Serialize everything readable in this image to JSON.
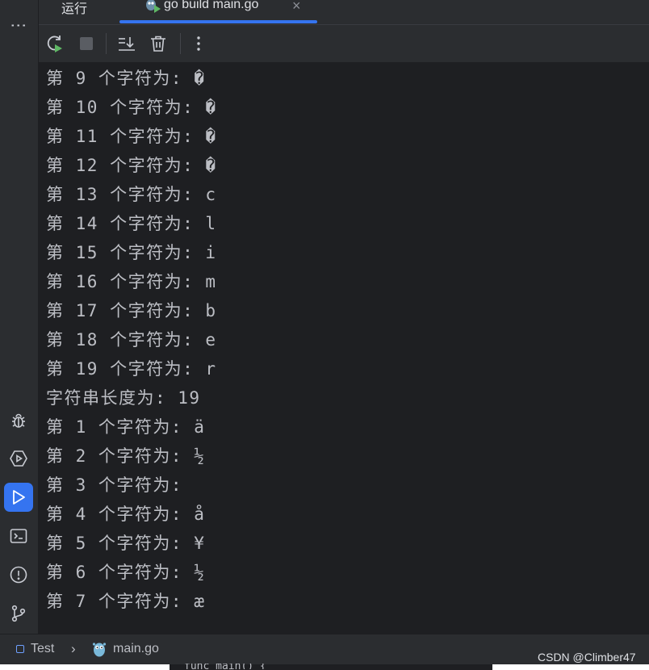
{
  "tabs": {
    "run_label": "运行",
    "active_label": "go build main.go",
    "close_glyph": "×"
  },
  "left_strip": {
    "more_glyph": "⋮",
    "icons": [
      "debug-icon",
      "services-icon",
      "run-icon",
      "terminal-icon",
      "problems-icon",
      "git-icon"
    ],
    "active": "run-icon"
  },
  "toolbar": {
    "icons": [
      "rerun-icon",
      "stop-icon",
      "scroll-to-end-icon",
      "clear-all-icon",
      "more-icon"
    ]
  },
  "console": {
    "lines": [
      "第 9 个字符为: �",
      "第 10 个字符为: �",
      "第 11 个字符为: �",
      "第 12 个字符为: �",
      "第 13 个字符为: c",
      "第 14 个字符为: l",
      "第 15 个字符为: i",
      "第 16 个字符为: m",
      "第 17 个字符为: b",
      "第 18 个字符为: e",
      "第 19 个字符为: r",
      "字符串长度为: 19",
      "第 1 个字符为: ä",
      "第 2 个字符为: ½",
      "第 3 个字符为: ",
      "第 4 个字符为: å",
      "第 5 个字符为: ¥",
      "第 6 个字符为: ½",
      "第 7 个字符为: æ"
    ]
  },
  "status_bar": {
    "breadcrumb_project": "Test",
    "breadcrumb_separator": "›",
    "breadcrumb_file": "main.go"
  },
  "watermark": "CSDN @Climber47",
  "below_clipped_text": "func main() {",
  "colors": {
    "background": "#1e1f22",
    "panel": "#2b2d30",
    "accent": "#3574f0",
    "text": "#bcbec4",
    "run_green": "#5fb865"
  }
}
